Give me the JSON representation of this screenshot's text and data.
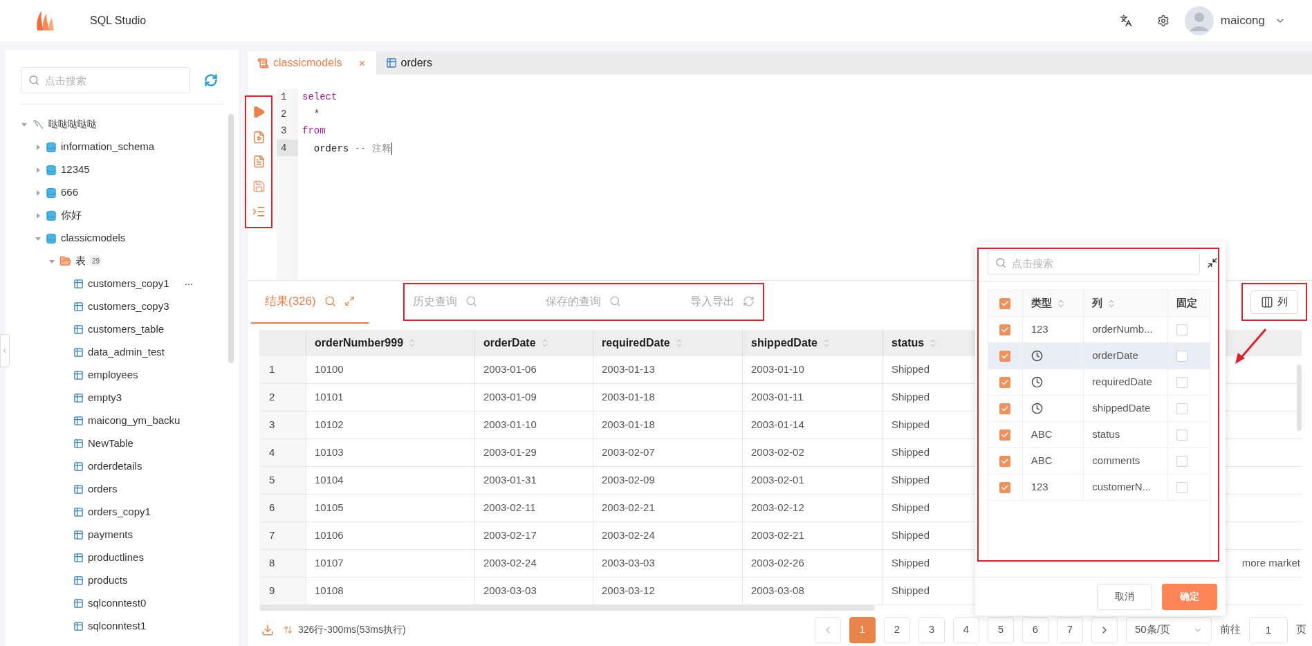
{
  "header": {
    "app_title": "SQL Studio",
    "user": "maicong"
  },
  "sidebar": {
    "search": {
      "placeholder": "点击搜索"
    },
    "tree": [
      {
        "label": "哒哒哒哒哒",
        "kind": "connection",
        "expanded": true,
        "children": [
          {
            "label": "information_schema",
            "kind": "database",
            "expanded": false
          },
          {
            "label": "12345",
            "kind": "database",
            "expanded": false
          },
          {
            "label": "666",
            "kind": "database",
            "expanded": false
          },
          {
            "label": "你好",
            "kind": "database",
            "expanded": false
          },
          {
            "label": "classicmodels",
            "kind": "database",
            "expanded": true,
            "children": [
              {
                "label": "表",
                "kind": "folder",
                "count": "29",
                "expanded": true,
                "children": [
                  {
                    "label": "customers_copy1",
                    "kind": "table",
                    "actions": "···"
                  },
                  {
                    "label": "customers_copy3",
                    "kind": "table"
                  },
                  {
                    "label": "customers_table",
                    "kind": "table"
                  },
                  {
                    "label": "data_admin_test",
                    "kind": "table"
                  },
                  {
                    "label": "employees",
                    "kind": "table"
                  },
                  {
                    "label": "empty3",
                    "kind": "table"
                  },
                  {
                    "label": "maicong_ym_backu",
                    "kind": "table"
                  },
                  {
                    "label": "NewTable",
                    "kind": "table"
                  },
                  {
                    "label": "orderdetails",
                    "kind": "table"
                  },
                  {
                    "label": "orders",
                    "kind": "table"
                  },
                  {
                    "label": "orders_copy1",
                    "kind": "table"
                  },
                  {
                    "label": "payments",
                    "kind": "table"
                  },
                  {
                    "label": "productlines",
                    "kind": "table"
                  },
                  {
                    "label": "products",
                    "kind": "table"
                  },
                  {
                    "label": "sqlconntest0",
                    "kind": "table"
                  },
                  {
                    "label": "sqlconntest1",
                    "kind": "table"
                  }
                ]
              }
            ]
          }
        ]
      }
    ]
  },
  "editor_tabs": [
    {
      "label": "classicmodels",
      "kind": "console",
      "selected": true,
      "closable": true
    },
    {
      "label": "orders",
      "kind": "table",
      "selected": false,
      "closable": false
    }
  ],
  "editor": {
    "lines": [
      {
        "number": "1",
        "current": false,
        "tokens": [
          {
            "text": "select",
            "kind": "keyword"
          }
        ]
      },
      {
        "number": "2",
        "current": false,
        "tokens": [
          {
            "text": "  *",
            "kind": "plain"
          }
        ]
      },
      {
        "number": "3",
        "current": false,
        "tokens": [
          {
            "text": "from",
            "kind": "keyword"
          }
        ]
      },
      {
        "number": "4",
        "current": true,
        "tokens": [
          {
            "text": "  orders",
            "kind": "plain"
          },
          {
            "text": " -- 注释",
            "kind": "comment"
          }
        ]
      }
    ]
  },
  "result_tabs": [
    {
      "label": "结果(326)",
      "kind": "results",
      "selected": true
    },
    {
      "label": "历史查询",
      "kind": "history",
      "selected": false
    },
    {
      "label": "保存的查询",
      "kind": "saved",
      "selected": false
    },
    {
      "label": "导入导出",
      "kind": "import_export",
      "selected": false
    }
  ],
  "columns_button": "列",
  "table": {
    "columns": [
      "orderNumber999",
      "orderDate",
      "requiredDate",
      "shippedDate",
      "status"
    ],
    "rows": [
      {
        "index": "1",
        "cells": [
          "10100",
          "2003-01-06",
          "2003-01-13",
          "2003-01-10",
          "Shipped"
        ]
      },
      {
        "index": "2",
        "cells": [
          "10101",
          "2003-01-09",
          "2003-01-18",
          "2003-01-11",
          "Shipped"
        ]
      },
      {
        "index": "3",
        "cells": [
          "10102",
          "2003-01-10",
          "2003-01-18",
          "2003-01-14",
          "Shipped"
        ]
      },
      {
        "index": "4",
        "cells": [
          "10103",
          "2003-01-29",
          "2003-02-07",
          "2003-02-02",
          "Shipped"
        ]
      },
      {
        "index": "5",
        "cells": [
          "10104",
          "2003-01-31",
          "2003-02-09",
          "2003-02-01",
          "Shipped"
        ]
      },
      {
        "index": "6",
        "cells": [
          "10105",
          "2003-02-11",
          "2003-02-21",
          "2003-02-12",
          "Shipped"
        ]
      },
      {
        "index": "7",
        "cells": [
          "10106",
          "2003-02-17",
          "2003-02-24",
          "2003-02-21",
          "Shipped"
        ]
      },
      {
        "index": "8",
        "cells": [
          "10107",
          "2003-02-24",
          "2003-03-03",
          "2003-02-26",
          "Shipped"
        ],
        "column_7": "more market"
      },
      {
        "index": "9",
        "cells": [
          "10108",
          "2003-03-03",
          "2003-03-12",
          "2003-03-08",
          "Shipped"
        ]
      }
    ]
  },
  "column_picker": {
    "search": {
      "placeholder": "点击搜索"
    },
    "all_checked": true,
    "headers": {
      "type": "类型",
      "column": "列",
      "pinned": "固定"
    },
    "items": [
      {
        "kind": "number",
        "type": "123",
        "name": "orderNumb...",
        "checked": true,
        "pinned": false,
        "highlighted": false
      },
      {
        "kind": "date",
        "name": "orderDate",
        "checked": true,
        "pinned": false,
        "highlighted": true
      },
      {
        "kind": "date",
        "name": "requiredDate",
        "checked": true,
        "pinned": false,
        "highlighted": false
      },
      {
        "kind": "date",
        "name": "shippedDate",
        "checked": true,
        "pinned": false,
        "highlighted": false
      },
      {
        "kind": "text",
        "type": "ABC",
        "name": "status",
        "checked": true,
        "pinned": false,
        "highlighted": false
      },
      {
        "kind": "text",
        "type": "ABC",
        "name": "comments",
        "checked": true,
        "pinned": false,
        "highlighted": false
      },
      {
        "kind": "number",
        "type": "123",
        "name": "customerN...",
        "checked": true,
        "pinned": false,
        "highlighted": false
      }
    ],
    "cancel": "取消",
    "confirm": "确定"
  },
  "status_bar": {
    "summary": "326行-300ms(53ms执行)"
  },
  "pagination": {
    "pages": [
      {
        "label": "1",
        "selected": true
      },
      {
        "label": "2",
        "selected": false
      },
      {
        "label": "3",
        "selected": false
      },
      {
        "label": "4",
        "selected": false
      },
      {
        "label": "5",
        "selected": false
      },
      {
        "label": "6",
        "selected": false
      },
      {
        "label": "7",
        "selected": false
      }
    ],
    "page_size": "50条/页",
    "goto_label": "前往",
    "goto_value": "1",
    "page_suffix": "页"
  }
}
